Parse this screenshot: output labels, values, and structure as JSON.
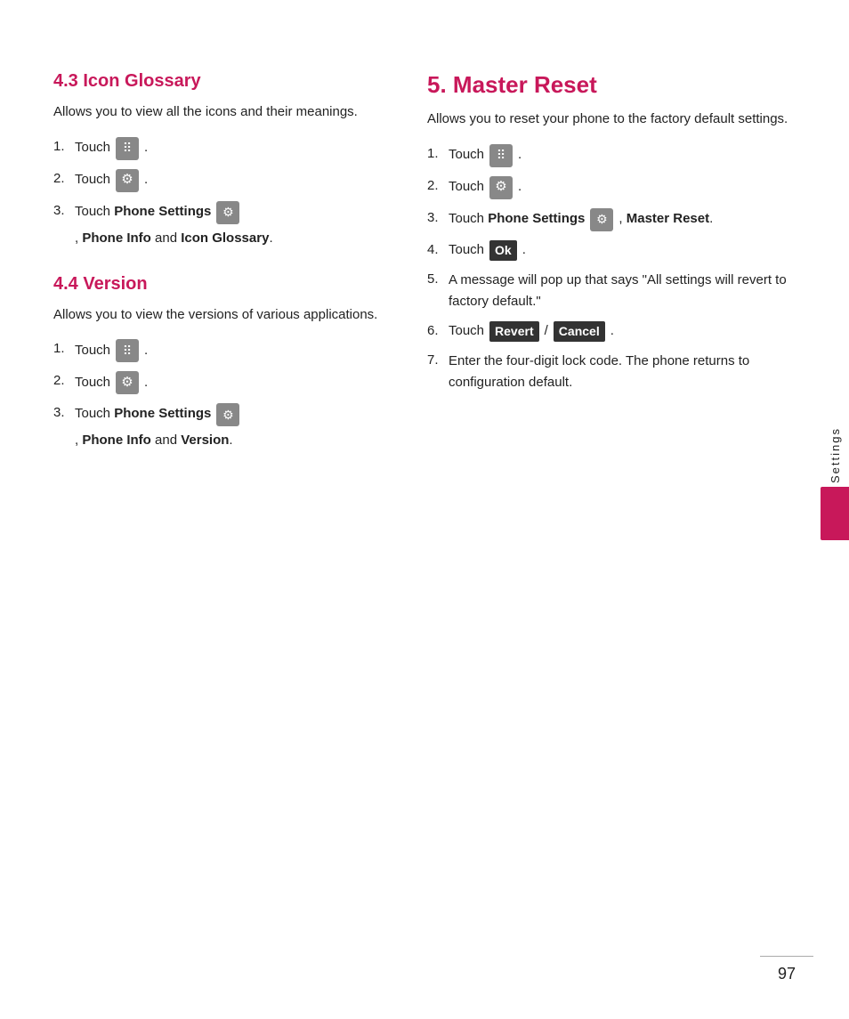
{
  "left": {
    "section1": {
      "heading": "4.3 Icon Glossary",
      "desc": "Allows you to view all the icons and their meanings.",
      "steps": [
        {
          "num": "1.",
          "text": "Touch",
          "icon": "grid"
        },
        {
          "num": "2.",
          "text": "Touch",
          "icon": "gear"
        },
        {
          "num": "3.",
          "text": "Touch",
          "bold_parts": [
            "Phone Settings",
            "Phone Info",
            "Icon Glossary"
          ],
          "has_icon": true,
          "full": "Touch Phone Settings , Phone Info and Icon Glossary."
        }
      ]
    },
    "section2": {
      "heading": "4.4 Version",
      "desc": "Allows you to view the versions of various applications.",
      "steps": [
        {
          "num": "1.",
          "text": "Touch",
          "icon": "grid"
        },
        {
          "num": "2.",
          "text": "Touch",
          "icon": "gear"
        },
        {
          "num": "3.",
          "text": "Touch",
          "bold_parts": [
            "Phone Settings",
            "Phone Info",
            "Version"
          ],
          "has_icon": true,
          "full": "Touch Phone Settings , Phone Info and Version."
        }
      ]
    }
  },
  "right": {
    "section1": {
      "heading": "5. Master Reset",
      "desc": "Allows you to reset your phone to the factory default settings.",
      "steps": [
        {
          "num": "1.",
          "text": "Touch",
          "icon": "grid"
        },
        {
          "num": "2.",
          "text": "Touch",
          "icon": "gear"
        },
        {
          "num": "3.",
          "text": "Touch",
          "bold_parts": [
            "Phone Settings",
            "Master Reset"
          ],
          "has_icon": true,
          "full": "Touch Phone Settings , Master Reset."
        },
        {
          "num": "4.",
          "text": "Touch",
          "icon": "ok"
        },
        {
          "num": "5.",
          "text": "A message will pop up that says “All settings will revert to factory default.”"
        },
        {
          "num": "6.",
          "text": "Touch",
          "icon": "revert_cancel"
        },
        {
          "num": "7.",
          "text": "Enter the four-digit lock code. The phone returns to configuration default."
        }
      ]
    }
  },
  "sidebar": {
    "label": "Settings"
  },
  "page_number": "97",
  "icons": {
    "grid_label": "menu grid icon",
    "gear_label": "settings gear icon",
    "ok_label": "Ok",
    "revert_label": "Revert",
    "cancel_label": "Cancel"
  }
}
